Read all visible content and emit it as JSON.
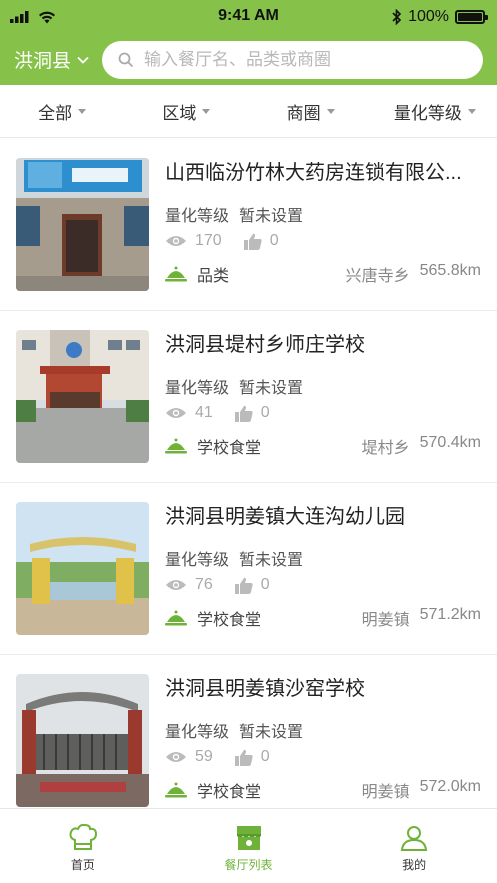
{
  "status_bar": {
    "time": "9:41 AM",
    "battery": "100%",
    "battery_level": 1.0
  },
  "header": {
    "city": "洪洞县",
    "search_placeholder": "输入餐厅名、品类或商圈"
  },
  "filters": [
    "全部",
    "区域",
    "商圈",
    "量化等级"
  ],
  "colors": {
    "brand_green": "#86c24a",
    "active_tab": "#6fb23a"
  },
  "restaurants": [
    {
      "name": "山西临汾竹林大药房连锁有限公...",
      "grade_label": "量化等级",
      "grade_value": "暂未设置",
      "views": "170",
      "likes": "0",
      "category": "品类",
      "area": "兴唐寺乡",
      "distance": "565.8km"
    },
    {
      "name": "洪洞县堤村乡师庄学校",
      "grade_label": "量化等级",
      "grade_value": "暂未设置",
      "views": "41",
      "likes": "0",
      "category": "学校食堂",
      "area": "堤村乡",
      "distance": "570.4km"
    },
    {
      "name": "洪洞县明姜镇大连沟幼儿园",
      "grade_label": "量化等级",
      "grade_value": "暂未设置",
      "views": "76",
      "likes": "0",
      "category": "学校食堂",
      "area": "明姜镇",
      "distance": "571.2km"
    },
    {
      "name": "洪洞县明姜镇沙窑学校",
      "grade_label": "量化等级",
      "grade_value": "暂未设置",
      "views": "59",
      "likes": "0",
      "category": "学校食堂",
      "area": "明姜镇",
      "distance": "572.0km"
    }
  ],
  "tabbar": [
    {
      "label": "首页",
      "icon": "chef-hat-icon"
    },
    {
      "label": "餐厅列表",
      "icon": "shop-icon"
    },
    {
      "label": "我的",
      "icon": "user-icon"
    }
  ]
}
